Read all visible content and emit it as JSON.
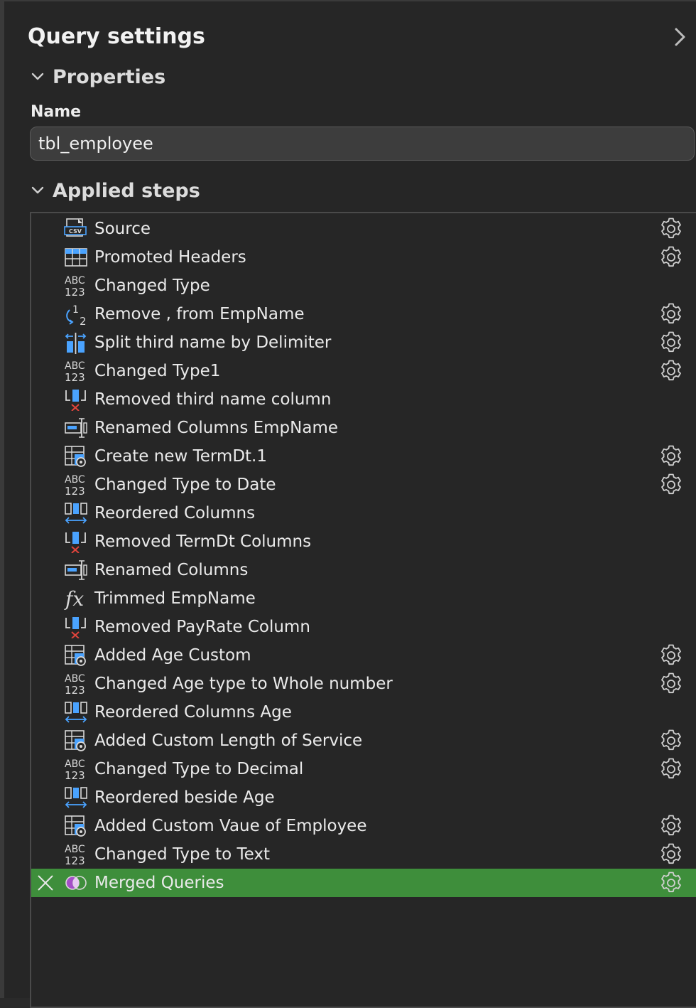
{
  "panel": {
    "title": "Query settings"
  },
  "properties": {
    "header": "Properties",
    "name_label": "Name",
    "name_value": "tbl_employee"
  },
  "applied_steps": {
    "header": "Applied steps",
    "steps": [
      {
        "label": "Source",
        "icon": "csv-icon",
        "gear": true
      },
      {
        "label": "Promoted Headers",
        "icon": "table-icon",
        "gear": true
      },
      {
        "label": "Changed Type",
        "icon": "abc123-icon",
        "gear": false
      },
      {
        "label": "Remove , from EmpName",
        "icon": "replace-values-icon",
        "gear": true
      },
      {
        "label": "Split third name by Delimiter",
        "icon": "split-column-icon",
        "gear": true
      },
      {
        "label": "Changed Type1",
        "icon": "abc123-icon",
        "gear": true
      },
      {
        "label": "Removed third name column",
        "icon": "remove-columns-icon",
        "gear": false
      },
      {
        "label": "Renamed Columns EmpName",
        "icon": "rename-column-icon",
        "gear": false
      },
      {
        "label": "Create new TermDt.1",
        "icon": "custom-column-icon",
        "gear": true
      },
      {
        "label": "Changed Type to Date",
        "icon": "abc123-icon",
        "gear": true
      },
      {
        "label": "Reordered Columns",
        "icon": "reorder-columns-icon",
        "gear": false
      },
      {
        "label": "Removed TermDt Columns",
        "icon": "remove-columns-icon",
        "gear": false
      },
      {
        "label": "Renamed Columns",
        "icon": "rename-column-icon",
        "gear": false
      },
      {
        "label": "Trimmed EmpName",
        "icon": "fx-icon",
        "gear": false
      },
      {
        "label": "Removed PayRate Column",
        "icon": "remove-columns-icon",
        "gear": false
      },
      {
        "label": "Added Age Custom",
        "icon": "custom-column-icon",
        "gear": true
      },
      {
        "label": "Changed Age type to Whole number",
        "icon": "abc123-icon",
        "gear": true
      },
      {
        "label": "Reordered Columns Age",
        "icon": "reorder-columns-icon",
        "gear": false
      },
      {
        "label": "Added Custom Length of Service",
        "icon": "custom-column-icon",
        "gear": true
      },
      {
        "label": "Changed Type to Decimal",
        "icon": "abc123-icon",
        "gear": true
      },
      {
        "label": "Reordered beside Age",
        "icon": "reorder-columns-icon",
        "gear": false
      },
      {
        "label": "Added Custom Vaue of Employee",
        "icon": "custom-column-icon",
        "gear": true
      },
      {
        "label": "Changed Type to Text",
        "icon": "abc123-icon",
        "gear": true
      },
      {
        "label": "Merged Queries",
        "icon": "merge-queries-icon",
        "gear": true,
        "selected": true
      }
    ]
  },
  "colors": {
    "background": "#262626",
    "selected_row": "#3e8e3b",
    "icon_blue": "#4aa3ff",
    "remove_red": "#e0443c",
    "merge_purple": "#a44fc8"
  }
}
